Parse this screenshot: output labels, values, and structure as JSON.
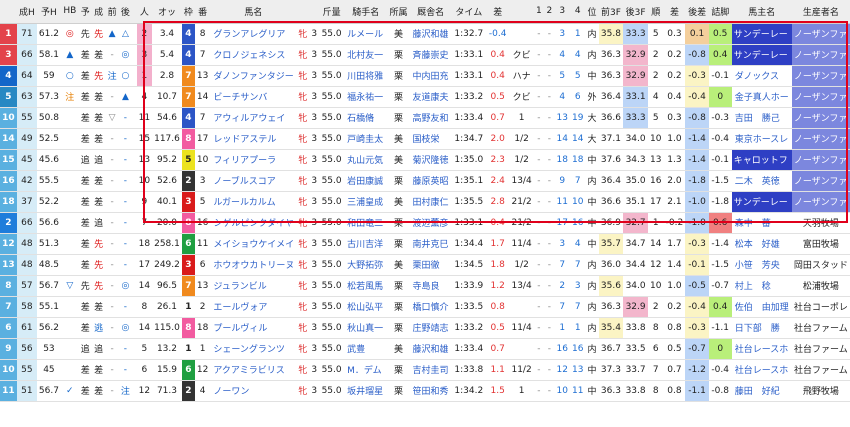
{
  "headers": [
    "",
    "成H",
    "予H",
    "HB",
    "予",
    "成",
    "前",
    "後",
    "",
    "人",
    "オッ",
    "枠",
    "番",
    "馬名",
    "",
    "",
    "斤量",
    "騎手名",
    "所属",
    "厩舎名",
    "タイム",
    "差",
    "",
    "1",
    "2",
    "3",
    "4",
    "位",
    "前3F",
    "後3F",
    "順",
    "差",
    "後差",
    "詰脚",
    "馬主名",
    "生産者名"
  ],
  "colors": {
    "frame1": "#ffffff",
    "frame2": "#333333",
    "frame3": "#d91b1b",
    "frame4": "#2c55c6",
    "frame5": "#ece31f",
    "frame6": "#1f9f41",
    "frame7": "#f08a1e",
    "frame8": "#f25ba0"
  },
  "rows": [
    {
      "tag": "1",
      "tagColor": "#e3434b",
      "sh": "71",
      "yh": "61.2",
      "hb": "◎",
      "yo": "先",
      "se": "先",
      "mae": "▲",
      "ato": "△",
      "ninki": "2",
      "odds": "3.4",
      "waku": "4",
      "ban": "8",
      "name": "グランアレグリア",
      "sex": "牝",
      "age": "3",
      "kin": "55.0",
      "jockey": "ルメール",
      "shozoku": "美",
      "trainer": "藤沢和雄",
      "time": "1:32.7",
      "diff": "-0.4",
      "chaku": "",
      "p1": "-",
      "p2": "-",
      "p3": "3",
      "p4": "1",
      "pos": "内",
      "zen": "35.8",
      "ato3": "33.3",
      "jun": "5",
      "sa": "0.3",
      "atosa": "0.1",
      "tsume": "0.5",
      "owner": "サンデーレー",
      "breeder": "ノーザンファ"
    },
    {
      "tag": "3",
      "tagColor": "#e3434b",
      "sh": "66",
      "yh": "58.1",
      "hb": "▲",
      "yo": "差",
      "se": "差",
      "mae": "-",
      "ato": "◎",
      "ninki": "3",
      "odds": "5.4",
      "waku": "4",
      "ban": "7",
      "name": "クロノジェネシス",
      "sex": "牝",
      "age": "3",
      "kin": "55.0",
      "jockey": "北村友一",
      "shozoku": "栗",
      "trainer": "斉藤崇史",
      "time": "1:33.1",
      "diff": "0.4",
      "chaku": "クビ",
      "p1": "-",
      "p2": "-",
      "p3": "4",
      "p4": "4",
      "pos": "内",
      "zen": "36.3",
      "ato3": "32.9",
      "jun": "2",
      "sa": "0.2",
      "atosa": "-0.8",
      "tsume": "0.4",
      "owner": "サンデーレー",
      "breeder": "ノーザンファ"
    },
    {
      "tag": "4",
      "tagColor": "#1366c9",
      "sh": "64",
      "yh": "59",
      "hb": "○",
      "yo": "差",
      "se": "先",
      "mae": "注",
      "ato": "○",
      "ninki": "1",
      "odds": "2.8",
      "waku": "7",
      "ban": "13",
      "name": "ダノンファンタジー",
      "sex": "牝",
      "age": "3",
      "kin": "55.0",
      "jockey": "川田将雅",
      "shozoku": "栗",
      "trainer": "中内田充",
      "time": "1:33.1",
      "diff": "0.4",
      "chaku": "ハナ",
      "p1": "-",
      "p2": "-",
      "p3": "5",
      "p4": "5",
      "pos": "中",
      "zen": "36.3",
      "ato3": "32.9",
      "jun": "2",
      "sa": "0.2",
      "atosa": "-0.3",
      "tsume": "-0.1",
      "owner": "ダノックス",
      "breeder": "ノーザンファ"
    },
    {
      "tag": "5",
      "tagColor": "#2788c3",
      "sh": "63",
      "yh": "57.3",
      "hb": "注",
      "yo": "差",
      "se": "差",
      "mae": "-",
      "ato": "▲",
      "ninki": "4",
      "odds": "10.7",
      "waku": "7",
      "ban": "14",
      "name": "ビーチサンバ",
      "sex": "牝",
      "age": "3",
      "kin": "55.0",
      "jockey": "福永祐一",
      "shozoku": "栗",
      "trainer": "友道康夫",
      "time": "1:33.2",
      "diff": "0.5",
      "chaku": "クビ",
      "p1": "-",
      "p2": "-",
      "p3": "4",
      "p4": "6",
      "pos": "外",
      "zen": "36.4",
      "ato3": "33.1",
      "jun": "4",
      "sa": "0.4",
      "atosa": "-0.4",
      "tsume": "0",
      "owner": "金子真人ホー",
      "breeder": "ノーザンファ"
    },
    {
      "tag": "10",
      "tagColor": "#5ab0e0",
      "sh": "55",
      "yh": "50.8",
      "hb": "",
      "yo": "差",
      "se": "差",
      "mae": "▽",
      "ato": "-",
      "ninki": "11",
      "odds": "54.6",
      "waku": "4",
      "ban": "7",
      "name": "アウィルアウェイ",
      "sex": "牝",
      "age": "3",
      "kin": "55.0",
      "jockey": "石橋脩",
      "shozoku": "栗",
      "trainer": "高野友和",
      "time": "1:33.4",
      "diff": "0.7",
      "chaku": "1",
      "p1": "-",
      "p2": "-",
      "p3": "13",
      "p4": "19",
      "pos": "大",
      "zen": "36.6",
      "ato3": "33.3",
      "jun": "5",
      "sa": "0.3",
      "atosa": "-0.8",
      "tsume": "-0.3",
      "owner": "吉田　勝己",
      "breeder": "ノーザンファ"
    },
    {
      "tag": "14",
      "tagColor": "#5ab0e0",
      "sh": "49",
      "yh": "52.5",
      "hb": "",
      "yo": "差",
      "se": "差",
      "mae": "-",
      "ato": "-",
      "ninki": "15",
      "odds": "117.6",
      "waku": "8",
      "ban": "17",
      "name": "レッドアステル",
      "sex": "牝",
      "age": "3",
      "kin": "55.0",
      "jockey": "戸崎圭太",
      "shozoku": "美",
      "trainer": "国枝栄",
      "time": "1:34.7",
      "diff": "2.0",
      "chaku": "1/2",
      "p1": "-",
      "p2": "-",
      "p3": "14",
      "p4": "14",
      "pos": "大",
      "zen": "37.1",
      "ato3": "34.0",
      "jun": "10",
      "sa": "1.0",
      "atosa": "-1.4",
      "tsume": "-0.4",
      "owner": "東京ホースレ",
      "breeder": "ノーザンファ"
    },
    {
      "tag": "15",
      "tagColor": "#5ab0e0",
      "sh": "45",
      "yh": "45.6",
      "hb": "",
      "yo": "追",
      "se": "追",
      "mae": "-",
      "ato": "-",
      "ninki": "13",
      "odds": "95.2",
      "waku": "5",
      "ban": "10",
      "name": "フィリアプーラ",
      "sex": "牝",
      "age": "3",
      "kin": "55.0",
      "jockey": "丸山元気",
      "shozoku": "美",
      "trainer": "菊沢隆徳",
      "time": "1:35.0",
      "diff": "2.3",
      "chaku": "1/2",
      "p1": "-",
      "p2": "-",
      "p3": "18",
      "p4": "18",
      "pos": "中",
      "zen": "37.6",
      "ato3": "34.3",
      "jun": "13",
      "sa": "1.3",
      "atosa": "-1.4",
      "tsume": "-0.1",
      "owner": "キャロットフ",
      "breeder": "ノーザンファ"
    },
    {
      "tag": "16",
      "tagColor": "#5ab0e0",
      "sh": "42",
      "yh": "55.5",
      "hb": "",
      "yo": "差",
      "se": "差",
      "mae": "-",
      "ato": "-",
      "ninki": "10",
      "odds": "52.6",
      "waku": "2",
      "ban": "3",
      "name": "ノーブルスコア",
      "sex": "牝",
      "age": "3",
      "kin": "55.0",
      "jockey": "岩田康誠",
      "shozoku": "栗",
      "trainer": "藤原英昭",
      "time": "1:35.1",
      "diff": "2.4",
      "chaku": "13/4",
      "p1": "-",
      "p2": "-",
      "p3": "9",
      "p4": "7",
      "pos": "内",
      "zen": "36.4",
      "ato3": "35.0",
      "jun": "16",
      "sa": "2.0",
      "atosa": "-1.8",
      "tsume": "-1.5",
      "owner": "二木　英徳",
      "breeder": "ノーザンファ"
    },
    {
      "tag": "18",
      "tagColor": "#5ab0e0",
      "sh": "37",
      "yh": "52.2",
      "hb": "",
      "yo": "差",
      "se": "差",
      "mae": "-",
      "ato": "-",
      "ninki": "9",
      "odds": "40.1",
      "waku": "3",
      "ban": "5",
      "name": "ルガールカルム",
      "sex": "牝",
      "age": "3",
      "kin": "55.0",
      "jockey": "三浦皇成",
      "shozoku": "美",
      "trainer": "田村康仁",
      "time": "1:35.5",
      "diff": "2.8",
      "chaku": "21/2",
      "p1": "-",
      "p2": "-",
      "p3": "11",
      "p4": "10",
      "pos": "中",
      "zen": "36.6",
      "ato3": "35.1",
      "jun": "17",
      "sa": "2.1",
      "atosa": "-1.0",
      "tsume": "-1.8",
      "owner": "サンデーレー",
      "breeder": "ノーザンファ"
    },
    {
      "tag": "2",
      "tagColor": "#1f7ddb",
      "sh": "66",
      "yh": "56.6",
      "hb": "",
      "yo": "差",
      "se": "追",
      "mae": "-",
      "ato": "-",
      "ninki": "7",
      "odds": "20.0",
      "waku": "8",
      "ban": "16",
      "name": "シゲルピンクダイヤ",
      "sex": "牝",
      "age": "3",
      "kin": "55.0",
      "jockey": "和田竜二",
      "shozoku": "栗",
      "trainer": "渡辺薫彦",
      "time": "1:33.1",
      "diff": "0.4",
      "chaku": "21/2",
      "p1": "-",
      "p2": "-",
      "p3": "17",
      "p4": "16",
      "pos": "中",
      "zen": "36.9",
      "ato3": "32.7",
      "jun": "1",
      "sa": "-0.2",
      "atosa": "-1.0",
      "tsume": "0.6",
      "owner": "森中　蕃",
      "breeder": "天羽牧場"
    },
    {
      "tag": "12",
      "tagColor": "#5ab0e0",
      "sh": "48",
      "yh": "51.3",
      "hb": "",
      "yo": "差",
      "se": "先",
      "mae": "-",
      "ato": "-",
      "ninki": "18",
      "odds": "258.1",
      "waku": "6",
      "ban": "11",
      "name": "メイショウケイメイ",
      "sex": "牝",
      "age": "3",
      "kin": "55.0",
      "jockey": "古川吉洋",
      "shozoku": "栗",
      "trainer": "南井克巳",
      "time": "1:34.4",
      "diff": "1.7",
      "chaku": "11/4",
      "p1": "-",
      "p2": "-",
      "p3": "3",
      "p4": "4",
      "pos": "中",
      "zen": "35.7",
      "ato3": "34.7",
      "jun": "14",
      "sa": "1.7",
      "atosa": "-0.3",
      "tsume": "-1.4",
      "owner": "松本　好雄",
      "breeder": "富田牧場"
    },
    {
      "tag": "13",
      "tagColor": "#5ab0e0",
      "sh": "48",
      "yh": "48.5",
      "hb": "",
      "yo": "差",
      "se": "先",
      "mae": "-",
      "ato": "-",
      "ninki": "17",
      "odds": "249.2",
      "waku": "3",
      "ban": "6",
      "name": "ホウオウカトリーヌ",
      "sex": "牝",
      "age": "3",
      "kin": "55.0",
      "jockey": "大野拓弥",
      "shozoku": "美",
      "trainer": "栗田徹",
      "time": "1:34.5",
      "diff": "1.8",
      "chaku": "1/2",
      "p1": "-",
      "p2": "-",
      "p3": "7",
      "p4": "7",
      "pos": "内",
      "zen": "36.0",
      "ato3": "34.4",
      "jun": "12",
      "sa": "1.4",
      "atosa": "-0.1",
      "tsume": "-1.5",
      "owner": "小笹　芳央",
      "breeder": "岡田スタッド"
    },
    {
      "tag": "8",
      "tagColor": "#5ab0e0",
      "sh": "57",
      "yh": "56.7",
      "hb": "▽",
      "yo": "先",
      "se": "先",
      "mae": "-",
      "ato": "◎",
      "ninki": "14",
      "odds": "96.5",
      "waku": "7",
      "ban": "13",
      "name": "ジュランビル",
      "sex": "牝",
      "age": "3",
      "kin": "55.0",
      "jockey": "松若風馬",
      "shozoku": "栗",
      "trainer": "寺島良",
      "time": "1:33.9",
      "diff": "1.2",
      "chaku": "13/4",
      "p1": "-",
      "p2": "-",
      "p3": "2",
      "p4": "3",
      "pos": "内",
      "zen": "35.6",
      "ato3": "34.0",
      "jun": "10",
      "sa": "1.0",
      "atosa": "-0.5",
      "tsume": "-0.7",
      "owner": "村上　稔",
      "breeder": "松浦牧場"
    },
    {
      "tag": "7",
      "tagColor": "#5ab0e0",
      "sh": "58",
      "yh": "55.1",
      "hb": "",
      "yo": "差",
      "se": "差",
      "mae": "-",
      "ato": "-",
      "ninki": "8",
      "odds": "26.1",
      "waku": "1",
      "ban": "2",
      "name": "エールヴォア",
      "sex": "牝",
      "age": "3",
      "kin": "55.0",
      "jockey": "松山弘平",
      "shozoku": "栗",
      "trainer": "橋口慎介",
      "time": "1:33.5",
      "diff": "0.8",
      "chaku": "",
      "p1": "-",
      "p2": "-",
      "p3": "7",
      "p4": "7",
      "pos": "内",
      "zen": "36.3",
      "ato3": "32.9",
      "jun": "2",
      "sa": "0.2",
      "atosa": "-0.4",
      "tsume": "0.4",
      "owner": "佐伯　由加理",
      "breeder": "社台コーポレ"
    },
    {
      "tag": "6",
      "tagColor": "#5ab0e0",
      "sh": "61",
      "yh": "56.2",
      "hb": "",
      "yo": "差",
      "se": "逃",
      "mae": "-",
      "ato": "◎",
      "ninki": "14",
      "odds": "115.0",
      "waku": "8",
      "ban": "18",
      "name": "プールヴィル",
      "sex": "牝",
      "age": "3",
      "kin": "55.0",
      "jockey": "秋山真一",
      "shozoku": "栗",
      "trainer": "庄野靖志",
      "time": "1:33.2",
      "diff": "0.5",
      "chaku": "11/4",
      "p1": "-",
      "p2": "-",
      "p3": "1",
      "p4": "1",
      "pos": "内",
      "zen": "35.4",
      "ato3": "33.8",
      "jun": "8",
      "sa": "0.8",
      "atosa": "-0.3",
      "tsume": "-1.1",
      "owner": "日下部　勝",
      "breeder": "社台ファーム"
    },
    {
      "tag": "9",
      "tagColor": "#5ab0e0",
      "sh": "56",
      "yh": "53",
      "hb": "",
      "yo": "追",
      "se": "追",
      "mae": "-",
      "ato": "-",
      "ninki": "5",
      "odds": "13.2",
      "waku": "1",
      "ban": "1",
      "name": "シェーングランツ",
      "sex": "牝",
      "age": "3",
      "kin": "55.0",
      "jockey": "武豊",
      "shozoku": "美",
      "trainer": "藤沢和雄",
      "time": "1:33.4",
      "diff": "0.7",
      "chaku": "",
      "p1": "-",
      "p2": "-",
      "p3": "16",
      "p4": "16",
      "pos": "内",
      "zen": "36.7",
      "ato3": "33.5",
      "jun": "6",
      "sa": "0.5",
      "atosa": "-0.7",
      "tsume": "0",
      "owner": "社台レースホ",
      "breeder": "社台ファーム"
    },
    {
      "tag": "10",
      "tagColor": "#5ab0e0",
      "sh": "55",
      "yh": "45",
      "hb": "",
      "yo": "差",
      "se": "差",
      "mae": "-",
      "ato": "-",
      "ninki": "6",
      "odds": "15.9",
      "waku": "6",
      "ban": "12",
      "name": "アクアミラビリス",
      "sex": "牝",
      "age": "3",
      "kin": "55.0",
      "jockey": "M．デム",
      "shozoku": "栗",
      "trainer": "吉村圭司",
      "time": "1:33.8",
      "diff": "1.1",
      "chaku": "11/2",
      "p1": "-",
      "p2": "-",
      "p3": "12",
      "p4": "13",
      "pos": "中",
      "zen": "37.3",
      "ato3": "33.7",
      "jun": "7",
      "sa": "0.7",
      "atosa": "-1.2",
      "tsume": "-0.4",
      "owner": "社台レースホ",
      "breeder": "社台ファーム"
    },
    {
      "tag": "11",
      "tagColor": "#5ab0e0",
      "sh": "51",
      "yh": "56.7",
      "hb": "✓",
      "yo": "差",
      "se": "差",
      "mae": "-",
      "ato": "注",
      "ninki": "12",
      "odds": "71.3",
      "waku": "2",
      "ban": "4",
      "name": "ノーワン",
      "sex": "牝",
      "age": "3",
      "kin": "55.0",
      "jockey": "坂井瑠星",
      "shozoku": "栗",
      "trainer": "笹田和秀",
      "time": "1:34.2",
      "diff": "1.5",
      "chaku": "1",
      "p1": "-",
      "p2": "-",
      "p3": "10",
      "p4": "11",
      "pos": "中",
      "zen": "36.3",
      "ato3": "33.8",
      "jun": "8",
      "sa": "0.8",
      "atosa": "-1.1",
      "tsume": "-0.8",
      "owner": "藤田　好紀",
      "breeder": "飛野牧場"
    }
  ]
}
